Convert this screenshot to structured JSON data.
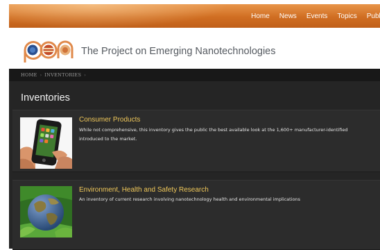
{
  "nav": {
    "items": [
      "Home",
      "News",
      "Events",
      "Topics",
      "Public"
    ]
  },
  "header": {
    "site_title": "The Project on Emerging Nanotechnologies",
    "logo_text": "pen"
  },
  "breadcrumb": [
    "HOME",
    "INVENTORIES"
  ],
  "page_title": "Inventories",
  "items": [
    {
      "title": "Consumer Products",
      "desc_lines": [
        "While not comprehensive, this inventory gives the public the best available look at the 1,600+ manufacturer-identified",
        "introduced to the market."
      ],
      "image_icon": "smartphone-image"
    },
    {
      "title": "Environment, Health and Safety Research",
      "desc_lines": [
        "An inventory of current research involving nanotechnology health and environmental implications"
      ],
      "image_icon": "earth-globe-image"
    }
  ],
  "colors": {
    "nav_orange": "#d06e22",
    "dark_bg": "#252525",
    "item_title": "#f0c85a"
  }
}
